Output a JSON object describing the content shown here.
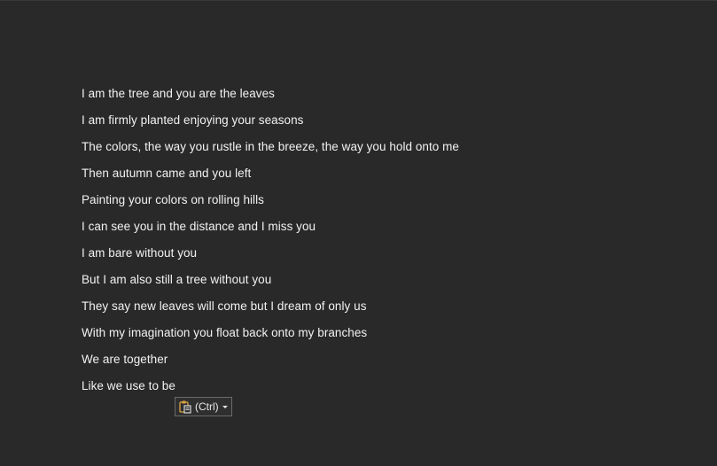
{
  "document": {
    "lines": [
      "I am the tree and you are the leaves",
      "I am firmly planted enjoying your seasons",
      "The colors, the way you rustle in the breeze, the way you hold onto me",
      "Then autumn came and you left",
      "Painting your colors on rolling hills",
      "I can see you in the distance and I miss you",
      "I am bare without you",
      "But I am also still a tree without you",
      "They say new leaves will come but I dream of only us",
      "With my imagination you float back onto my branches",
      "We are together",
      "Like we use to be"
    ]
  },
  "paste_options": {
    "label": "(Ctrl)",
    "icon": "clipboard-paste-icon"
  },
  "colors": {
    "background": "#292929",
    "text": "#f2f2f2",
    "paste_icon": "#d9a441"
  }
}
